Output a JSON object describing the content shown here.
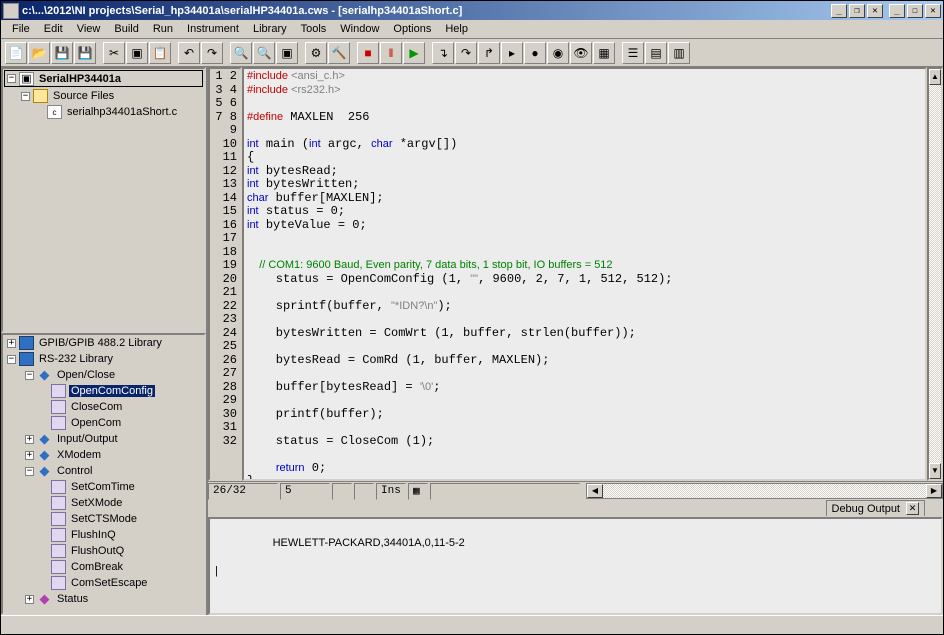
{
  "title": "c:\\...\\2012\\NI projects\\Serial_hp34401a\\serialHP34401a.cws - [serialhp34401aShort.c]",
  "menus": [
    "File",
    "Edit",
    "View",
    "Build",
    "Run",
    "Instrument",
    "Library",
    "Tools",
    "Window",
    "Options",
    "Help"
  ],
  "project_tree": {
    "root": "SerialHP34401a",
    "folder": "Source Files",
    "file": "serialhp34401aShort.c"
  },
  "library_tree": {
    "top_cut": "GPIB/GPIB 488.2 Library",
    "lib": "RS-232 Library",
    "groups": [
      {
        "name": "Open/Close",
        "expanded": true,
        "items": [
          "OpenComConfig",
          "CloseCom",
          "OpenCom"
        ],
        "selected": "OpenComConfig"
      },
      {
        "name": "Input/Output",
        "expanded": false
      },
      {
        "name": "XModem",
        "expanded": false
      },
      {
        "name": "Control",
        "expanded": true,
        "items": [
          "SetComTime",
          "SetXMode",
          "SetCTSMode",
          "FlushInQ",
          "FlushOutQ",
          "ComBreak",
          "ComSetEscape"
        ]
      },
      {
        "name": "Status",
        "expanded": false
      }
    ]
  },
  "code_lines": [
    {
      "n": 1,
      "t": "pp",
      "s": "#include <ansi_c.h>"
    },
    {
      "n": 2,
      "t": "pp",
      "s": "#include <rs232.h>"
    },
    {
      "n": 3,
      "t": "",
      "s": ""
    },
    {
      "n": 4,
      "t": "pp2",
      "s": "#define MAXLEN  256"
    },
    {
      "n": 5,
      "t": "",
      "s": ""
    },
    {
      "n": 6,
      "t": "decl",
      "s": "int main (int argc, char *argv[])"
    },
    {
      "n": 7,
      "t": "",
      "s": "{"
    },
    {
      "n": 8,
      "t": "decl2",
      "s": "int bytesRead;"
    },
    {
      "n": 9,
      "t": "decl2",
      "s": "int bytesWritten;"
    },
    {
      "n": 10,
      "t": "decl3",
      "s": "char buffer[MAXLEN];"
    },
    {
      "n": 11,
      "t": "decl2",
      "s": "int status = 0;"
    },
    {
      "n": 12,
      "t": "decl2",
      "s": "int byteValue = 0;"
    },
    {
      "n": 13,
      "t": "",
      "s": ""
    },
    {
      "n": 14,
      "t": "",
      "s": ""
    },
    {
      "n": 15,
      "t": "cm",
      "s": "    // COM1: 9600 Baud, Even parity, 7 data bits, 1 stop bit, IO buffers = 512"
    },
    {
      "n": 16,
      "t": "stmt",
      "s": "    status = OpenComConfig (1, \"\", 9600, 2, 7, 1, 512, 512);"
    },
    {
      "n": 17,
      "t": "",
      "s": ""
    },
    {
      "n": 18,
      "t": "stmt",
      "s": "    sprintf(buffer, \"*IDN?\\n\");"
    },
    {
      "n": 19,
      "t": "",
      "s": ""
    },
    {
      "n": 20,
      "t": "stmt",
      "s": "    bytesWritten = ComWrt (1, buffer, strlen(buffer));"
    },
    {
      "n": 21,
      "t": "",
      "s": ""
    },
    {
      "n": 22,
      "t": "stmt",
      "s": "    bytesRead = ComRd (1, buffer, MAXLEN);"
    },
    {
      "n": 23,
      "t": "",
      "s": ""
    },
    {
      "n": 24,
      "t": "stmt",
      "s": "    buffer[bytesRead] = '\\0';"
    },
    {
      "n": 25,
      "t": "",
      "s": ""
    },
    {
      "n": 26,
      "t": "stmt",
      "s": "    printf(buffer);"
    },
    {
      "n": 27,
      "t": "",
      "s": ""
    },
    {
      "n": 28,
      "t": "stmt",
      "s": "    status = CloseCom (1);"
    },
    {
      "n": 29,
      "t": "",
      "s": ""
    },
    {
      "n": 30,
      "t": "ret",
      "s": "    return 0;"
    },
    {
      "n": 31,
      "t": "",
      "s": "}"
    },
    {
      "n": 32,
      "t": "",
      "s": ""
    }
  ],
  "status_cells": [
    "26/32",
    "5",
    "",
    "",
    "Ins",
    "▦",
    ""
  ],
  "output_tab": "Debug Output",
  "output_text": "HEWLETT-PACKARD,34401A,0,11-5-2\n\n|"
}
